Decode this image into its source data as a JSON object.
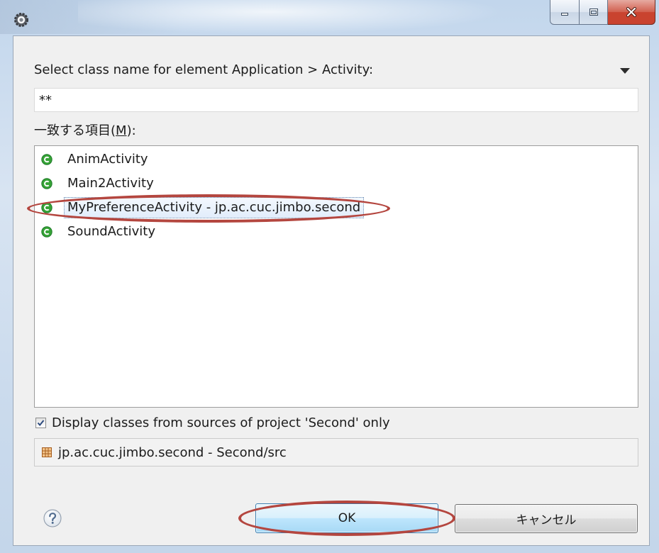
{
  "window": {
    "app_icon": "app-icon",
    "controls": {
      "minimize_icon": "minimize-icon",
      "maximize_icon": "maximize-icon",
      "close_icon": "close-icon"
    }
  },
  "prompt": {
    "label": "Select class name for element Application > Activity:",
    "menu_icon": "view-menu-triangle-icon"
  },
  "filter": {
    "value": "**"
  },
  "matches": {
    "label": "一致する項目(M):",
    "mnemonic": "M",
    "items": [
      {
        "label": "AnimActivity",
        "icon": "class-icon",
        "selected": false
      },
      {
        "label": "Main2Activity",
        "icon": "class-icon",
        "selected": false
      },
      {
        "label": "MyPreferenceActivity - jp.ac.cuc.jimbo.second",
        "icon": "class-icon",
        "selected": true
      },
      {
        "label": "SoundActivity",
        "icon": "class-icon",
        "selected": false
      }
    ]
  },
  "options": {
    "source_filter_label": "Display classes from sources of project 'Second' only",
    "source_filter_checked": true
  },
  "details": {
    "package_icon": "package-icon",
    "package_label": "jp.ac.cuc.jimbo.second - Second/src"
  },
  "buttons": {
    "help_icon": "help-icon",
    "ok_label": "OK",
    "cancel_label": "キャンセル"
  },
  "colors": {
    "annotation": "#b4463f",
    "class_icon": "#36a336",
    "close_button": "#c9432f",
    "selection_border": "#6d8cb1"
  }
}
